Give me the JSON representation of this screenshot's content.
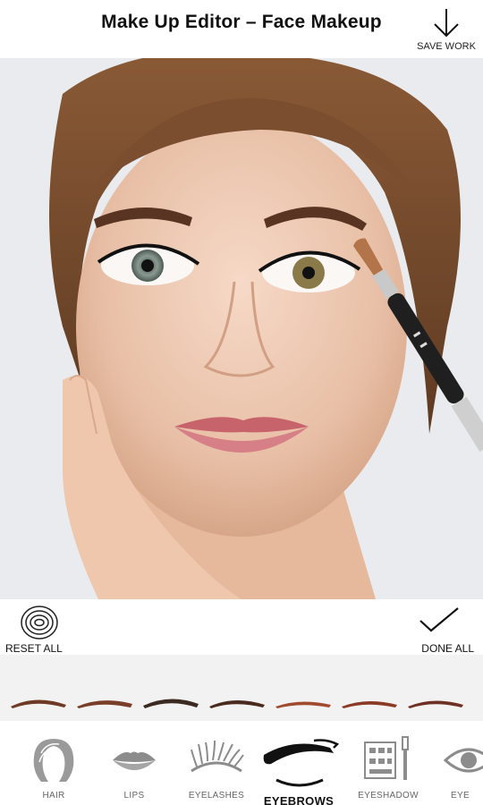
{
  "header": {
    "title": "Make Up Editor – Face Makeup",
    "save_label": "SAVE WORK"
  },
  "controls": {
    "reset_label": "RESET ALL",
    "done_label": "DONE ALL"
  },
  "eyebrow_styles": [
    "brow-1",
    "brow-2",
    "brow-3",
    "brow-4",
    "brow-5",
    "brow-6",
    "brow-7",
    "brow-8"
  ],
  "tabs": [
    {
      "label": "HAIR",
      "icon": "hair-icon"
    },
    {
      "label": "LIPS",
      "icon": "lips-icon"
    },
    {
      "label": "EYELASHES",
      "icon": "eyelashes-icon"
    },
    {
      "label": "EYEBROWS",
      "icon": "eyebrows-icon",
      "active": true
    },
    {
      "label": "EYESHADOW",
      "icon": "eyeshadow-icon"
    },
    {
      "label": "EYE",
      "icon": "eye-icon"
    }
  ],
  "colors": {
    "brow": "#6e3a26",
    "icon": "#9a9a9a",
    "accent": "#111111"
  }
}
